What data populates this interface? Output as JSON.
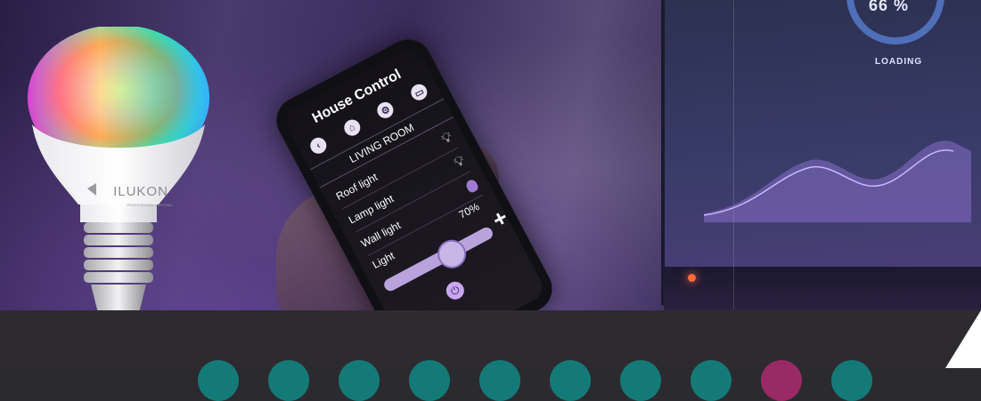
{
  "laptop": {
    "loading_percent": "66 %",
    "loading_label": "LOADING"
  },
  "phone": {
    "title": "House Control",
    "icons": [
      "back-icon",
      "home-icon",
      "gear-icon",
      "tv-icon"
    ],
    "room": "LIVING ROOM",
    "rows": [
      {
        "label": "Roof light",
        "icon": "bulb-on-icon"
      },
      {
        "label": "Lamp light",
        "icon": "bulb-on-icon"
      },
      {
        "label": "Wall light",
        "icon": "bulb-purple-icon"
      }
    ],
    "light_label": "Light",
    "light_value": "70%",
    "light_level": 0.7
  },
  "bulb": {
    "brand": "ILUKON",
    "tagline": "PROFESSIONAL LIGHTING"
  },
  "footer": {
    "circles": [
      "teal",
      "teal",
      "teal",
      "teal",
      "teal",
      "teal",
      "teal",
      "teal",
      "magenta",
      "teal"
    ],
    "colors": {
      "teal": "#147a78",
      "magenta": "#9a2a66"
    }
  }
}
